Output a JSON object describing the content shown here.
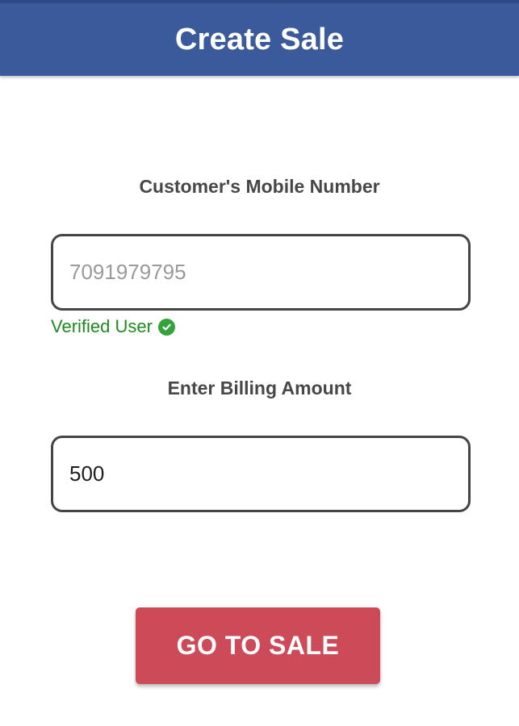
{
  "header": {
    "title": "Create Sale"
  },
  "mobile": {
    "label": "Customer's Mobile Number",
    "value": "7091979795",
    "status": "Verified User",
    "status_icon": "check-circle-icon",
    "status_color": "#1e8a1e"
  },
  "amount": {
    "label": "Enter Billing Amount",
    "value": "500"
  },
  "actions": {
    "go_to_sale_label": "GO TO SALE"
  },
  "colors": {
    "header_bg": "#3a5a9b",
    "button_bg": "#cd4a59",
    "verified_green": "#33a33a"
  }
}
